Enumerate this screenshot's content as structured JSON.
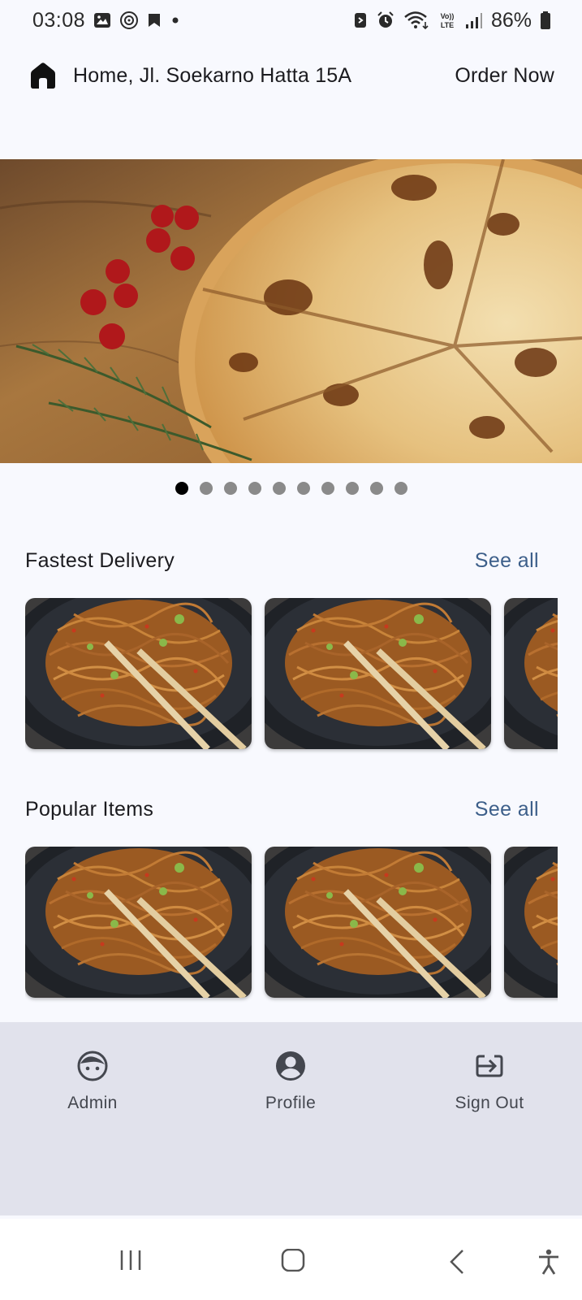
{
  "status_bar": {
    "time": "03:08",
    "battery": "86%",
    "left_icons": [
      "gallery-icon",
      "target-icon",
      "bookmark-icon",
      "dot-icon"
    ],
    "right_icons": [
      "nfc-icon",
      "alarm-icon",
      "wifi-icon",
      "volte-icon",
      "signal-icon",
      "battery-icon"
    ]
  },
  "app_bar": {
    "location": "Home, Jl. Soekarno Hatta 15A",
    "order_now": "Order Now"
  },
  "carousel": {
    "slide_count": 10,
    "active_index": 0
  },
  "sections": {
    "fastest": {
      "title": "Fastest Delivery",
      "see_all": "See all"
    },
    "popular": {
      "title": "Popular Items",
      "see_all": "See all"
    }
  },
  "bottom_nav": {
    "items": [
      {
        "label": "Admin",
        "icon": "face-icon"
      },
      {
        "label": "Profile",
        "icon": "account-circle-icon"
      },
      {
        "label": "Sign Out",
        "icon": "exit-icon"
      }
    ]
  },
  "colors": {
    "background": "#f8f9fe",
    "accent": "#3d5f8a",
    "nav_background": "#e1e2ec"
  }
}
